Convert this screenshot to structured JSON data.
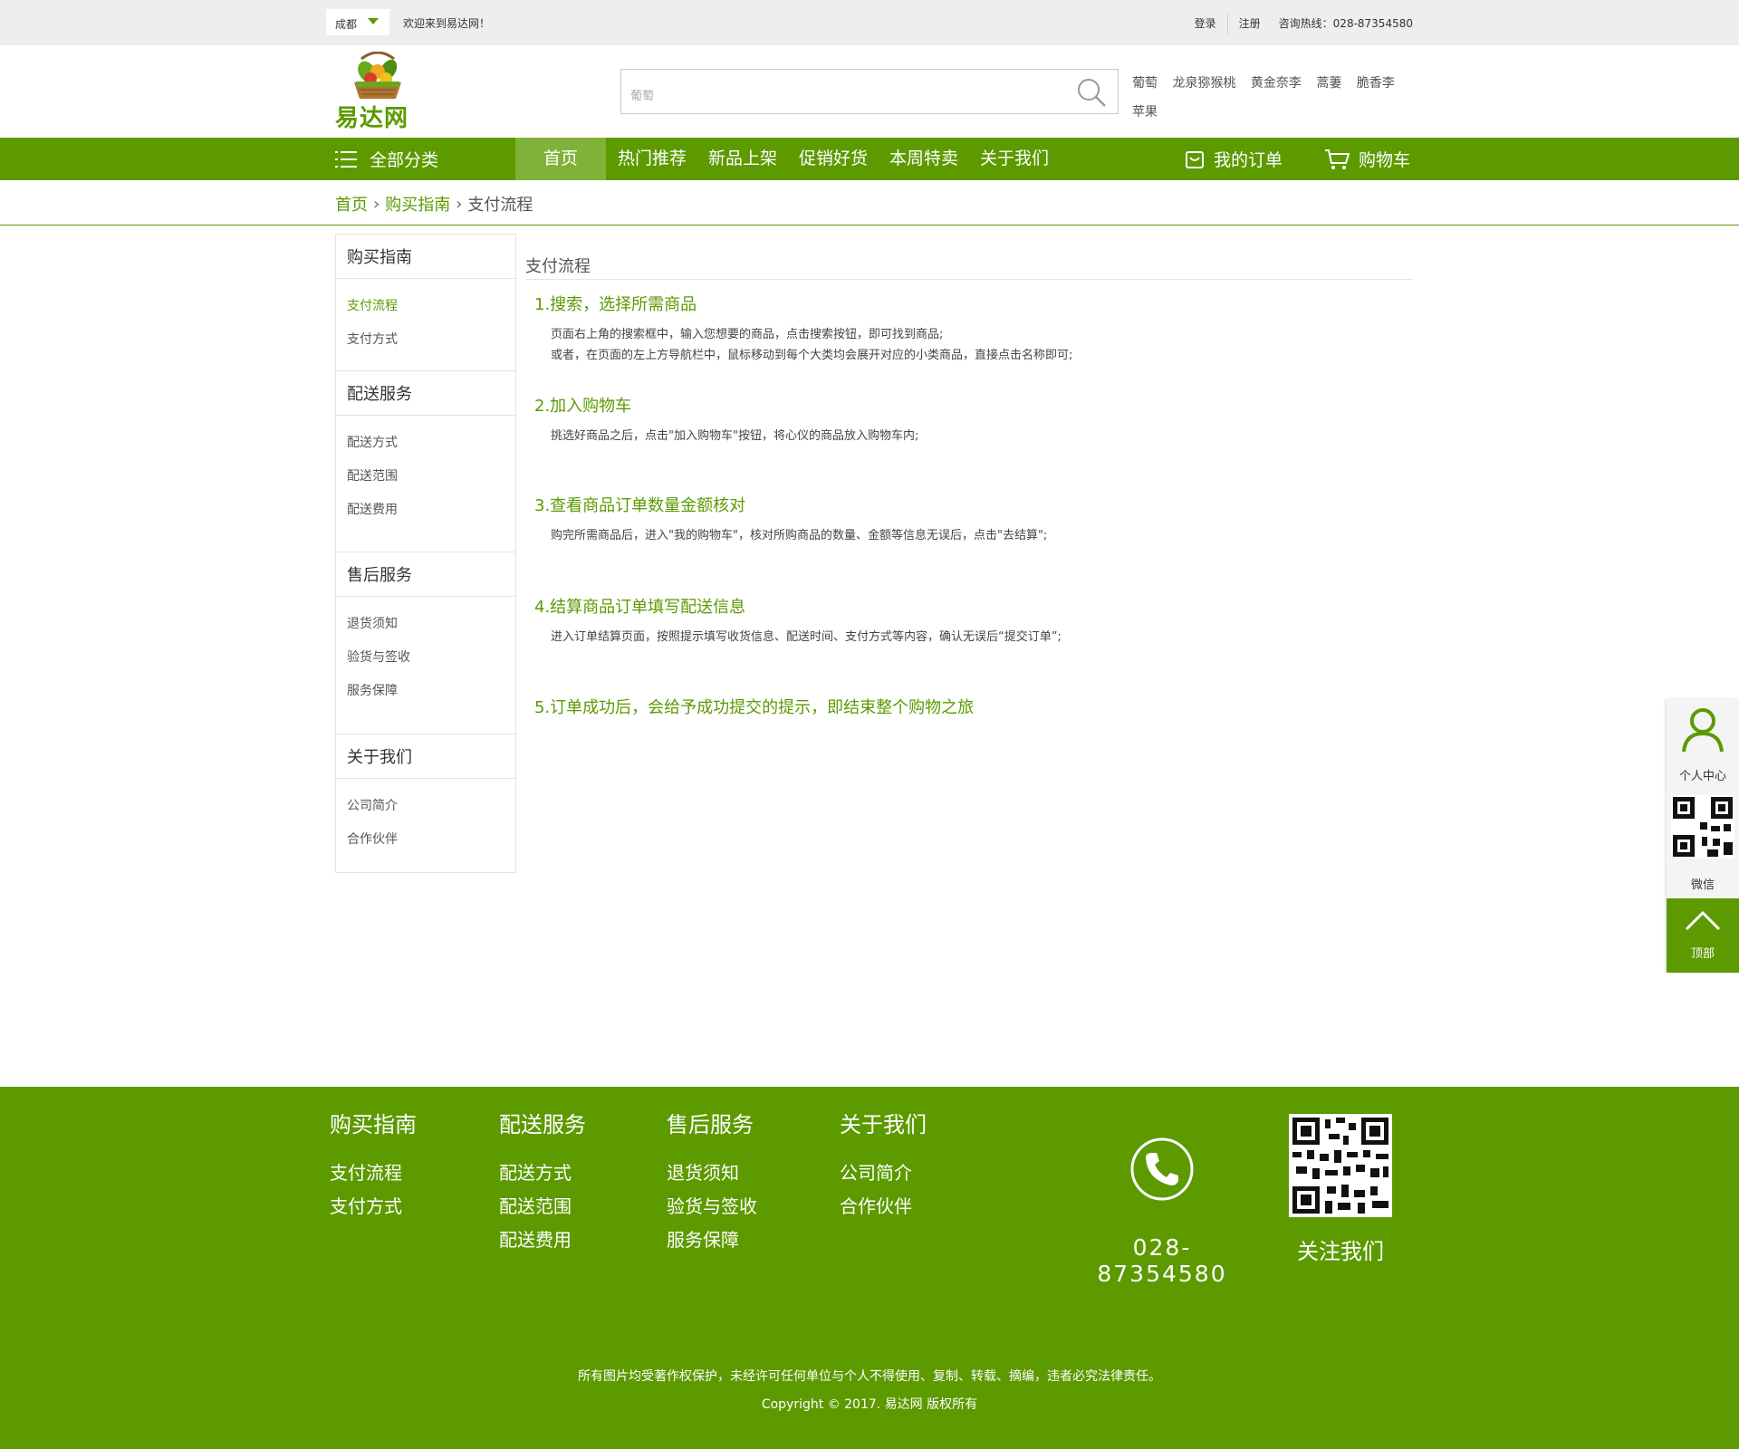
{
  "topbar": {
    "city": "成都",
    "welcome": "欢迎来到易达网！",
    "login": "登录",
    "register": "注册",
    "hotline": "咨询热线：028-87354580"
  },
  "header": {
    "logo_text": "易达网",
    "search_placeholder": "葡萄",
    "hot_words": [
      "葡萄",
      "龙泉猕猴桃",
      "黄金奈李",
      "蒿萋",
      "脆香李",
      "苹果"
    ]
  },
  "nav": {
    "all_categories": "全部分类",
    "items": [
      "首页",
      "热门推荐",
      "新品上架",
      "促销好货",
      "本周特卖",
      "关于我们"
    ],
    "active_index": 0,
    "my_orders": "我的订单",
    "cart": "购物车"
  },
  "breadcrumb": {
    "home": "首页",
    "section": "购买指南",
    "current": "支付流程"
  },
  "sidebar": [
    {
      "title": "购买指南",
      "links": [
        "支付流程",
        "支付方式"
      ],
      "active": "支付流程"
    },
    {
      "title": "配送服务",
      "links": [
        "配送方式",
        "配送范围",
        "配送费用"
      ]
    },
    {
      "title": "售后服务",
      "links": [
        "退货须知",
        "验货与签收",
        "服务保障"
      ]
    },
    {
      "title": "关于我们",
      "links": [
        "公司简介",
        "合作伙伴"
      ]
    }
  ],
  "content": {
    "title": "支付流程",
    "steps": [
      {
        "heading": "1.搜索，选择所需商品",
        "lines": [
          "页面右上角的搜索框中，输入您想要的商品，点击搜索按钮，即可找到商品;",
          "或者，在页面的左上方导航栏中，鼠标移动到每个大类均会展开对应的小类商品，直接点击名称即可;"
        ]
      },
      {
        "heading": "2.加入购物车",
        "lines": [
          "挑选好商品之后，点击\"加入购物车\"按钮，将心仪的商品放入购物车内;"
        ]
      },
      {
        "heading": "3.查看商品订单数量金额核对",
        "lines": [
          "购完所需商品后，进入\"我的购物车\"，核对所购商品的数量、金额等信息无误后，点击\"去结算\";"
        ]
      },
      {
        "heading": "4.结算商品订单填写配送信息",
        "lines": [
          "进入订单结算页面，按照提示填写收货信息、配送时间、支付方式等内容，确认无误后“提交订单”;"
        ]
      },
      {
        "heading": "5.订单成功后，会给予成功提交的提示，即结束整个购物之旅",
        "lines": []
      }
    ]
  },
  "float_panel": {
    "personal": "个人中心",
    "wechat": "微信",
    "top": "顶部"
  },
  "footer": {
    "columns": [
      {
        "title": "购买指南",
        "links": [
          "支付流程",
          "支付方式"
        ]
      },
      {
        "title": "配送服务",
        "links": [
          "配送方式",
          "配送范围",
          "配送费用"
        ]
      },
      {
        "title": "售后服务",
        "links": [
          "退货须知",
          "验货与签收",
          "服务保障"
        ]
      },
      {
        "title": "关于我们",
        "links": [
          "公司简介",
          "合作伙伴"
        ]
      }
    ],
    "phone": "028-87354580",
    "follow": "关注我们",
    "notice": "所有图片均受著作权保护，未经许可任何单位与个人不得使用、复制、转载、摘编，违者必究法律责任。",
    "copyright": "Copyright © 2017. 易达网 版权所有"
  },
  "colors": {
    "brand_green": "#5c9a00",
    "nav_active": "#80b23a",
    "topbar_bg": "#eeeeee"
  }
}
